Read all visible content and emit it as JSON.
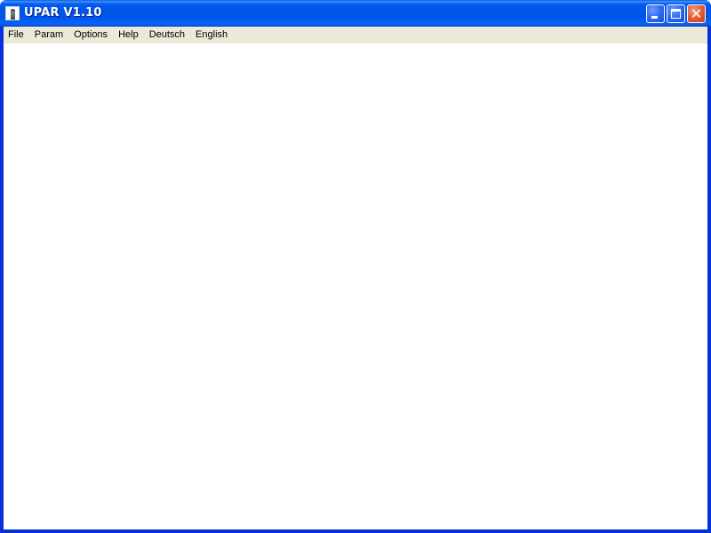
{
  "window": {
    "title": "UPAR V1.10",
    "icon": "java-app-icon",
    "controls": {
      "minimize": "minimize-icon",
      "maximize": "maximize-icon",
      "close": "close-icon",
      "close_glyph": "✕"
    }
  },
  "menubar": {
    "items": [
      {
        "label": "File"
      },
      {
        "label": "Param"
      },
      {
        "label": "Options"
      },
      {
        "label": "Help"
      },
      {
        "label": "Deutsch"
      },
      {
        "label": "English"
      }
    ]
  },
  "colors": {
    "titlebar": "#0054e3",
    "menubar": "#ece9d8",
    "client": "#ffffff",
    "close_button": "#e05a30"
  }
}
